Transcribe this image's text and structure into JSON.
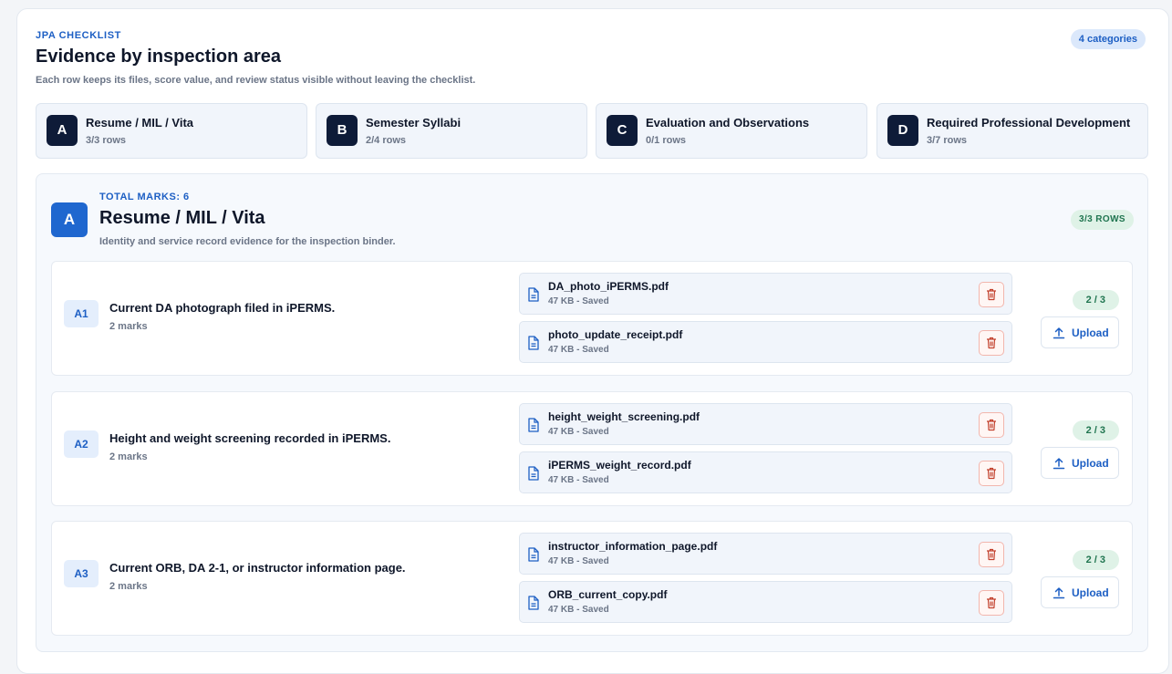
{
  "header": {
    "eyebrow": "JPA CHECKLIST",
    "title": "Evidence by inspection area",
    "subtitle": "Each row keeps its files, score value, and review status visible without leaving the checklist.",
    "category_count": "4 categories"
  },
  "categories": [
    {
      "letter": "A",
      "name": "Resume / MIL / Vita",
      "rows": "3/3 rows"
    },
    {
      "letter": "B",
      "name": "Semester Syllabi",
      "rows": "2/4 rows"
    },
    {
      "letter": "C",
      "name": "Evaluation and Observations",
      "rows": "0/1 rows"
    },
    {
      "letter": "D",
      "name": "Required Professional Development",
      "rows": "3/7 rows"
    }
  ],
  "section": {
    "letter": "A",
    "total_marks": "TOTAL MARKS: 6",
    "title": "Resume / MIL / Vita",
    "description": "Identity and service record evidence for the inspection binder.",
    "rows_badge": "3/3 ROWS",
    "items": [
      {
        "code": "A1",
        "requirement": "Current DA photograph filed in iPERMS.",
        "marks": "2 marks",
        "score": "2 / 3",
        "upload_label": "Upload",
        "files": [
          {
            "name": "DA_photo_iPERMS.pdf",
            "meta": "47 KB - Saved"
          },
          {
            "name": "photo_update_receipt.pdf",
            "meta": "47 KB - Saved"
          }
        ]
      },
      {
        "code": "A2",
        "requirement": "Height and weight screening recorded in iPERMS.",
        "marks": "2 marks",
        "score": "2 / 3",
        "upload_label": "Upload",
        "files": [
          {
            "name": "height_weight_screening.pdf",
            "meta": "47 KB - Saved"
          },
          {
            "name": "iPERMS_weight_record.pdf",
            "meta": "47 KB - Saved"
          }
        ]
      },
      {
        "code": "A3",
        "requirement": "Current ORB, DA 2-1, or instructor information page.",
        "marks": "2 marks",
        "score": "2 / 3",
        "upload_label": "Upload",
        "files": [
          {
            "name": "instructor_information_page.pdf",
            "meta": "47 KB - Saved"
          },
          {
            "name": "ORB_current_copy.pdf",
            "meta": "47 KB - Saved"
          }
        ]
      }
    ]
  },
  "icons": {
    "file": "document-icon",
    "delete": "trash-icon",
    "upload": "upload-icon"
  },
  "colors": {
    "accent": "#1d5fc4",
    "navy": "#0e1b38",
    "success": "#207550",
    "danger": "#c2412d"
  }
}
